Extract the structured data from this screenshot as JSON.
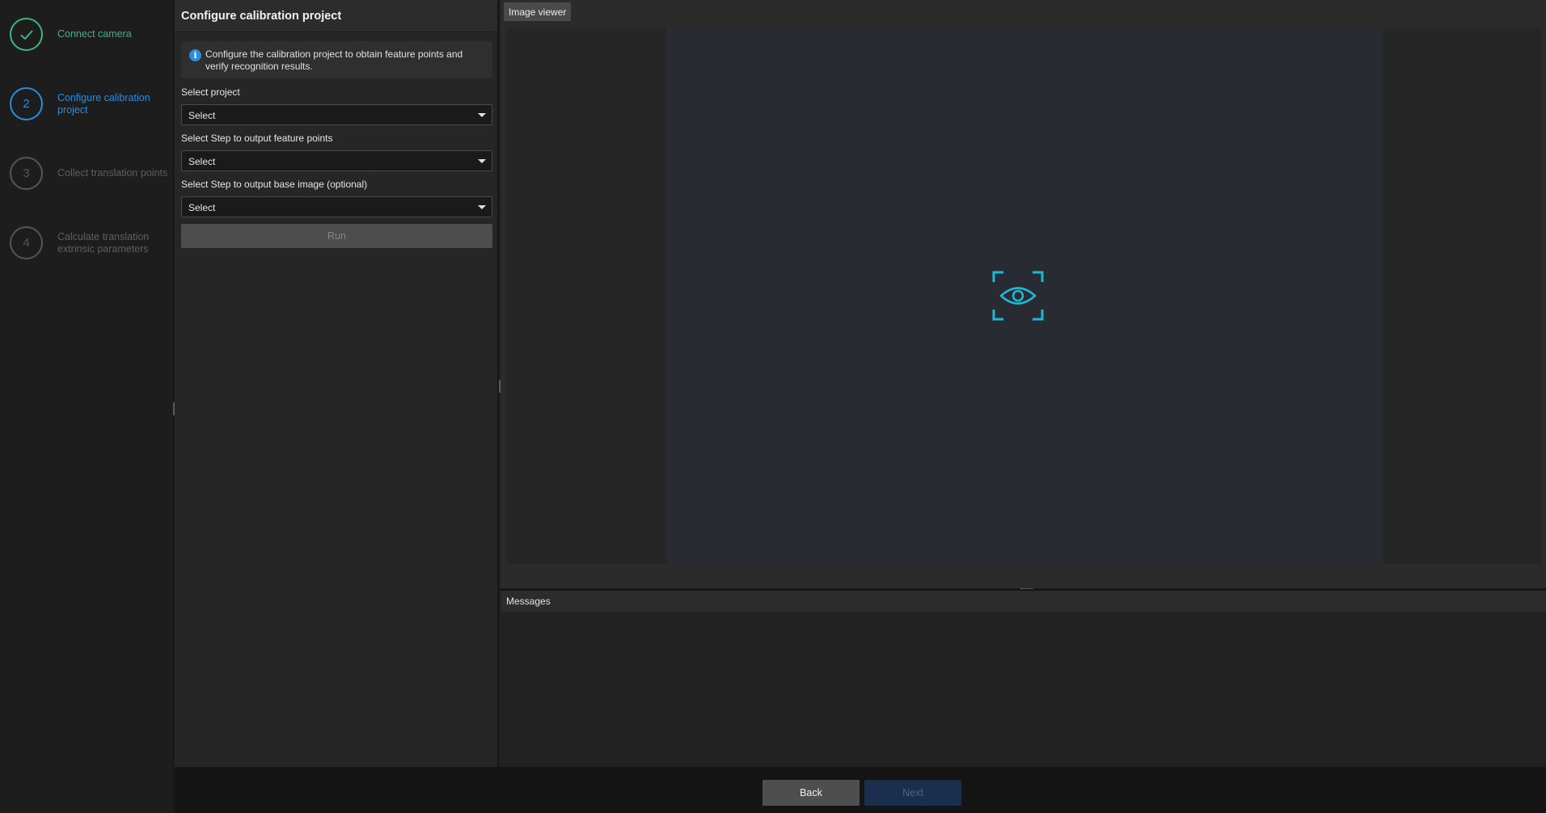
{
  "steps": [
    {
      "number": "✓",
      "label": "Connect camera",
      "state": "done"
    },
    {
      "number": "2",
      "label": "Configure calibration project",
      "state": "active"
    },
    {
      "number": "3",
      "label": "Collect translation points",
      "state": "pending"
    },
    {
      "number": "4",
      "label": "Calculate translation extrinsic parameters",
      "state": "pending"
    }
  ],
  "config": {
    "title": "Configure calibration project",
    "info": "Configure the calibration project to obtain feature points and verify recognition results.",
    "fields": [
      {
        "label": "Select project",
        "value": "Select"
      },
      {
        "label": "Select Step to output feature points",
        "value": "Select"
      },
      {
        "label": "Select Step to output base image (optional)",
        "value": "Select"
      }
    ],
    "run_label": "Run"
  },
  "viewer": {
    "tab_label": "Image viewer",
    "placeholder_icon": "eye-focus-icon",
    "icon_color": "#1fb7d8"
  },
  "messages": {
    "title": "Messages"
  },
  "footer": {
    "back_label": "Back",
    "next_label": "Next"
  },
  "colors": {
    "done": "#3fb57f",
    "active": "#2a8ce0",
    "pending": "#555555"
  }
}
